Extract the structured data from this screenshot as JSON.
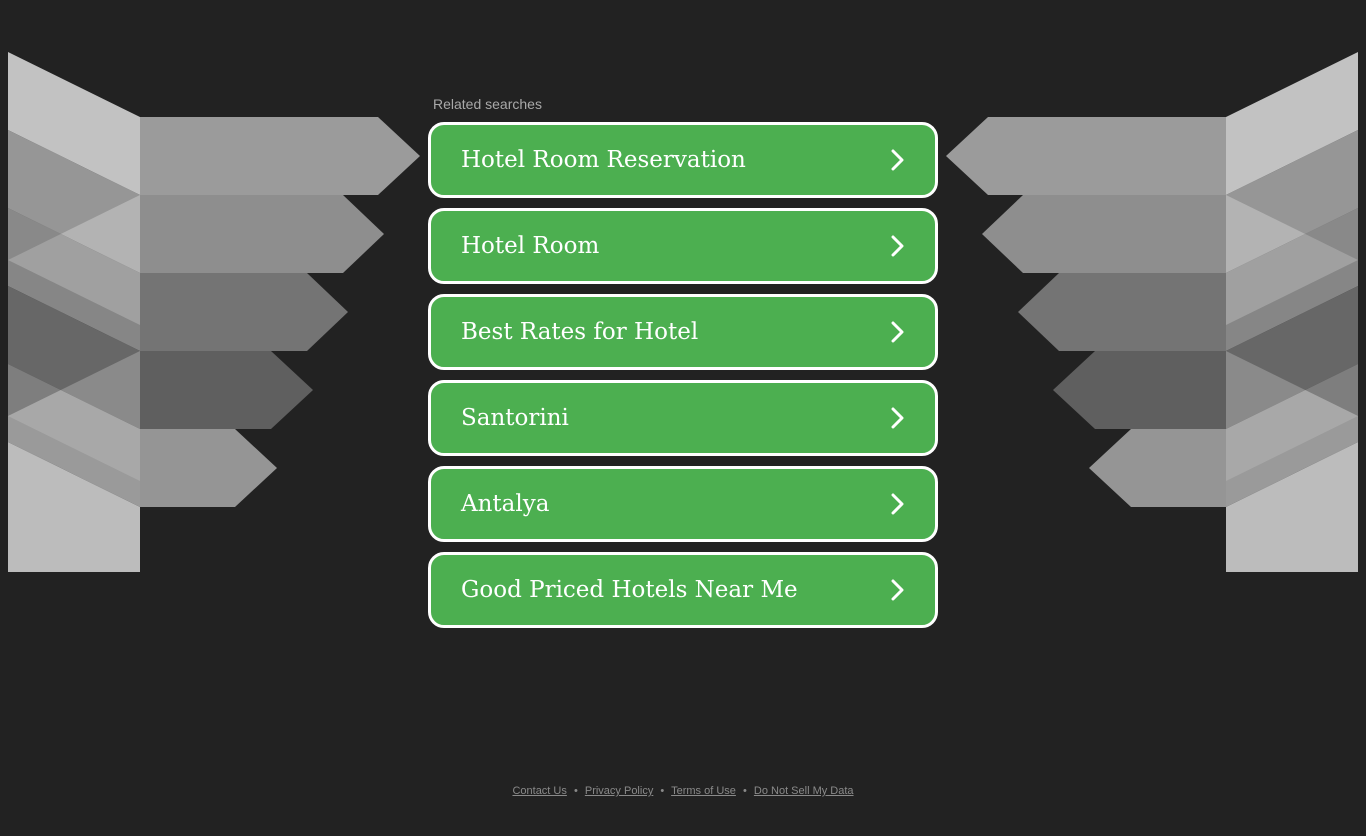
{
  "related": {
    "heading": "Related searches",
    "items": [
      {
        "label": "Hotel Room Reservation"
      },
      {
        "label": "Hotel Room"
      },
      {
        "label": "Best Rates for Hotel"
      },
      {
        "label": "Santorini"
      },
      {
        "label": "Antalya"
      },
      {
        "label": "Good Priced Hotels Near Me"
      }
    ],
    "button_color": "#4caf50",
    "border_color": "#ffffff",
    "item_icon": "chevron-right-icon"
  },
  "footer": {
    "links": [
      {
        "label": "Contact Us"
      },
      {
        "label": "Privacy Policy"
      },
      {
        "label": "Terms of Use"
      },
      {
        "label": "Do Not Sell My Data"
      }
    ],
    "separator": "•"
  },
  "theme": {
    "background": "#222222"
  }
}
